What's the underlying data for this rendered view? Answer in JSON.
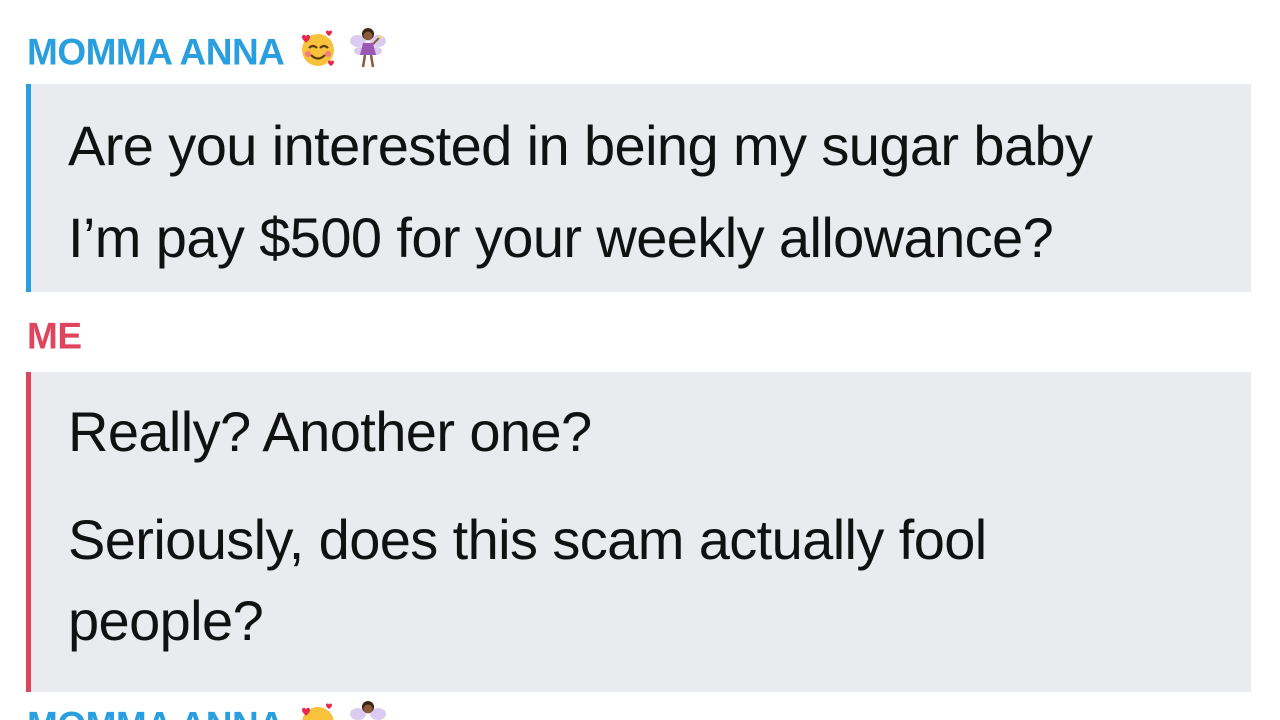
{
  "messages": [
    {
      "sender": "MOMMA ANNA",
      "sender_color": "#2a9fe0",
      "sender_emojis": [
        "smiling-face-with-hearts-icon",
        "fairy-icon"
      ],
      "lines": [
        "Are you interested in being my sugar baby",
        "I’m pay $500 for your weekly allowance?"
      ]
    },
    {
      "sender": "ME",
      "sender_color": "#e0455e",
      "lines": [
        "Really? Another one?",
        "Seriously, does this scam actually fool",
        "people?"
      ]
    },
    {
      "sender": "MOMMA ANNA",
      "sender_color": "#2a9fe0",
      "sender_emojis": [
        "smiling-face-with-hearts-icon",
        "fairy-icon"
      ]
    }
  ],
  "colors": {
    "bubble_background": "#e9ebee",
    "message_text": "#111111"
  }
}
